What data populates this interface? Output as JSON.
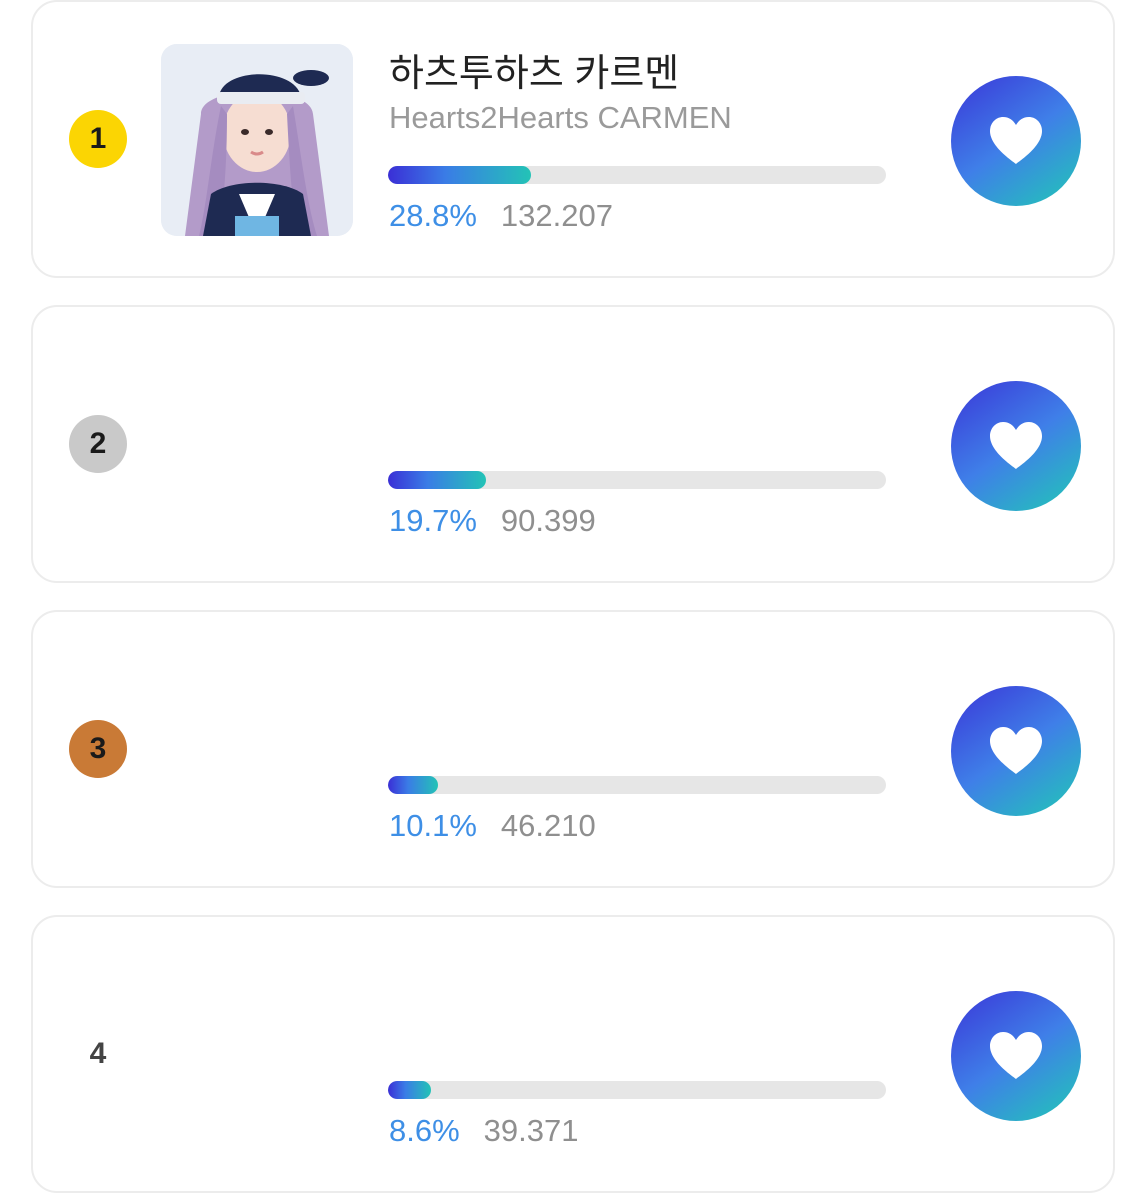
{
  "colors": {
    "gold": "#fbd503",
    "silver": "#c9c9c9",
    "bronze": "#c97a36",
    "percent_text": "#3e8fe6",
    "bar_gradient": [
      "#3a2fd6",
      "#23c3b6"
    ]
  },
  "entries": [
    {
      "rank": "1",
      "rank_badge": "gold",
      "name_ko": "하츠투하츠 카르멘",
      "name_en": "Hearts2Hearts CARMEN",
      "percent_label": "28.8%",
      "percent": 28.8,
      "votes": "132.207",
      "has_photo": true,
      "icon": "heart-icon"
    },
    {
      "rank": "2",
      "rank_badge": "silver",
      "name_ko": "",
      "name_en": "",
      "percent_label": "19.7%",
      "percent": 19.7,
      "votes": "90.399",
      "has_photo": false,
      "icon": "heart-icon"
    },
    {
      "rank": "3",
      "rank_badge": "bronze",
      "name_ko": "",
      "name_en": "",
      "percent_label": "10.1%",
      "percent": 10.1,
      "votes": "46.210",
      "has_photo": false,
      "icon": "heart-icon"
    },
    {
      "rank": "4",
      "rank_badge": "none",
      "name_ko": "",
      "name_en": "",
      "percent_label": "8.6%",
      "percent": 8.6,
      "votes": "39.371",
      "has_photo": false,
      "icon": "heart-icon"
    }
  ]
}
